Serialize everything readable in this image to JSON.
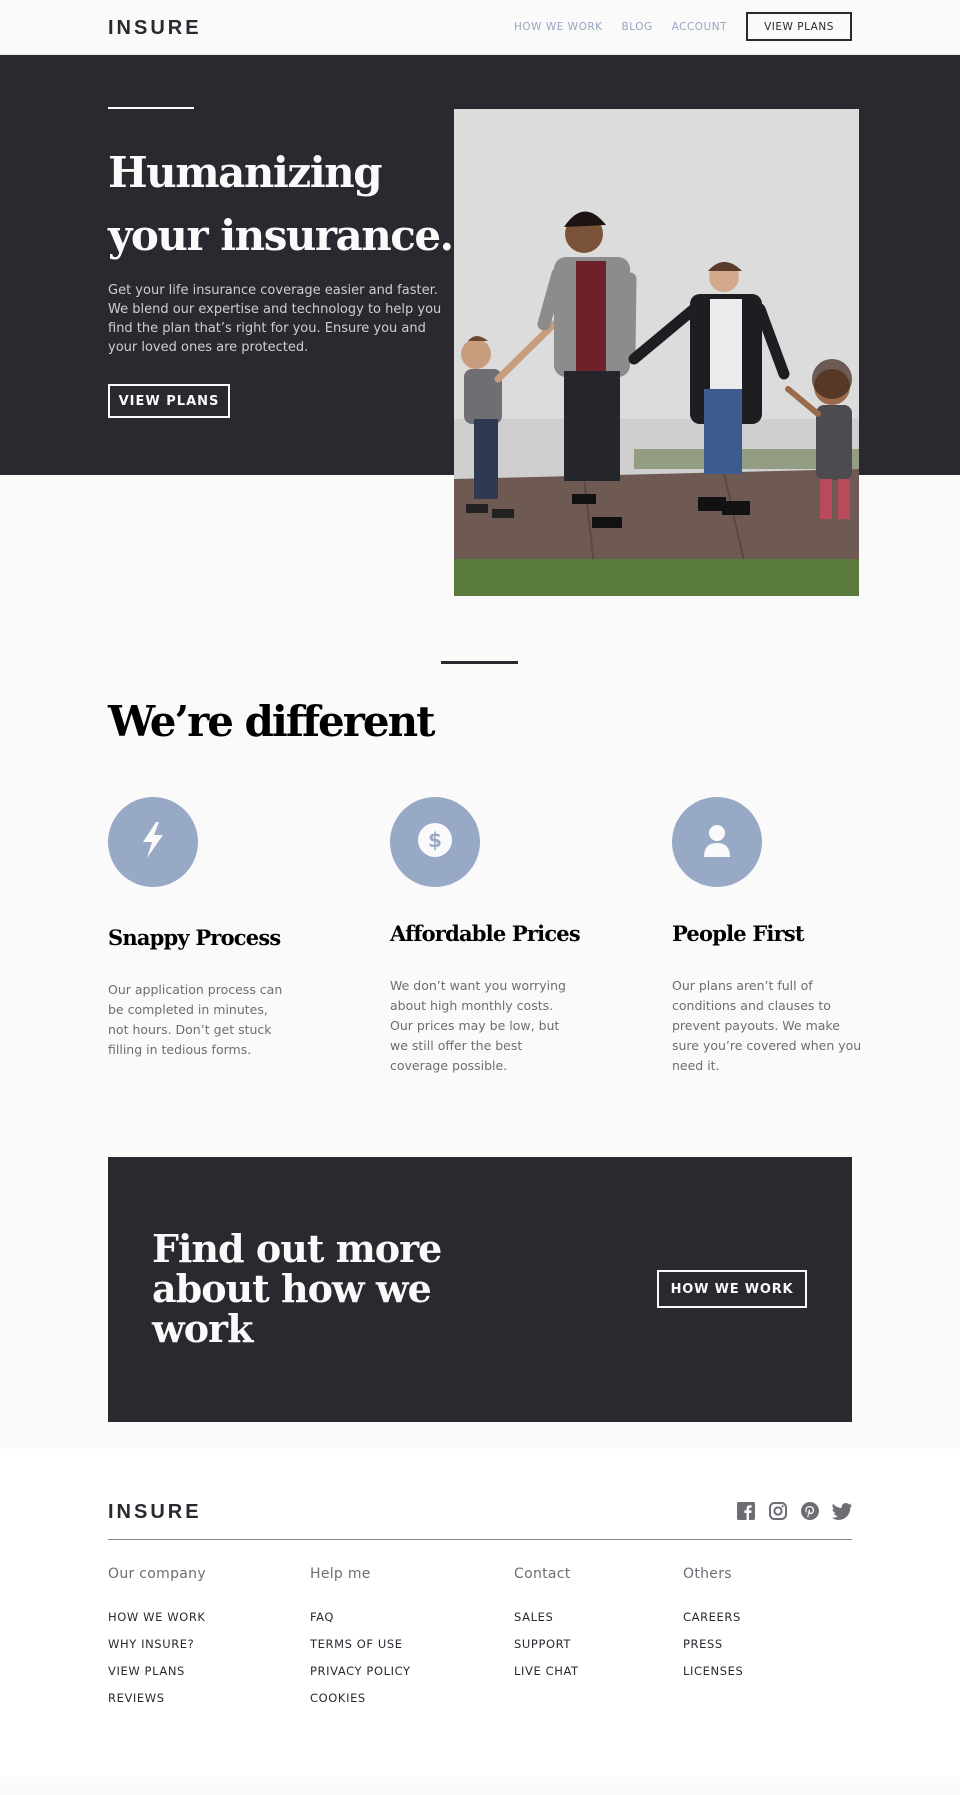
{
  "header": {
    "logo": "INSURE",
    "nav": [
      {
        "label": "HOW WE WORK"
      },
      {
        "label": "BLOG"
      },
      {
        "label": "ACCOUNT"
      }
    ],
    "cta_label": "VIEW PLANS"
  },
  "hero": {
    "title_line1": "Humanizing",
    "title_line2": "your insurance.",
    "text": "Get your life insurance coverage easier and faster. We blend our expertise and technology to help you find the plan that’s right for you. Ensure you and your loved ones are protected.",
    "button_label": "VIEW PLANS"
  },
  "different": {
    "title": "We’re different",
    "features": [
      {
        "icon": "lightning-icon",
        "title": "Snappy Process",
        "text": "Our application process can be completed in minutes, not hours. Don’t get stuck filling in tedious forms."
      },
      {
        "icon": "dollar-icon",
        "title": "Affordable Prices",
        "text": "We don’t want you worrying about high monthly costs. Our prices may be low, but we still offer the best coverage possible."
      },
      {
        "icon": "person-icon",
        "title": "People First",
        "text": "Our plans aren’t full of conditions and clauses to prevent payouts. We make sure you’re covered when you need it."
      }
    ]
  },
  "cta": {
    "title": "Find out more about how we work",
    "button_label": "HOW WE WORK"
  },
  "footer": {
    "logo": "INSURE",
    "socials": [
      "facebook-icon",
      "instagram-icon",
      "pinterest-icon",
      "twitter-icon"
    ],
    "columns": [
      {
        "heading": "Our company",
        "links": [
          "HOW WE WORK",
          "WHY INSURE?",
          "VIEW PLANS",
          "REVIEWS"
        ]
      },
      {
        "heading": "Help me",
        "links": [
          "FAQ",
          "TERMS OF USE",
          "PRIVACY POLICY",
          "COOKIES"
        ]
      },
      {
        "heading": "Contact",
        "links": [
          "SALES",
          "SUPPORT",
          "LIVE CHAT"
        ]
      },
      {
        "heading": "Others",
        "links": [
          "CAREERS",
          "PRESS",
          "LICENSES"
        ]
      }
    ]
  },
  "colors": {
    "dark": "#2c2830",
    "accent": "#98a9c6",
    "nav_link": "#98a5c2"
  }
}
